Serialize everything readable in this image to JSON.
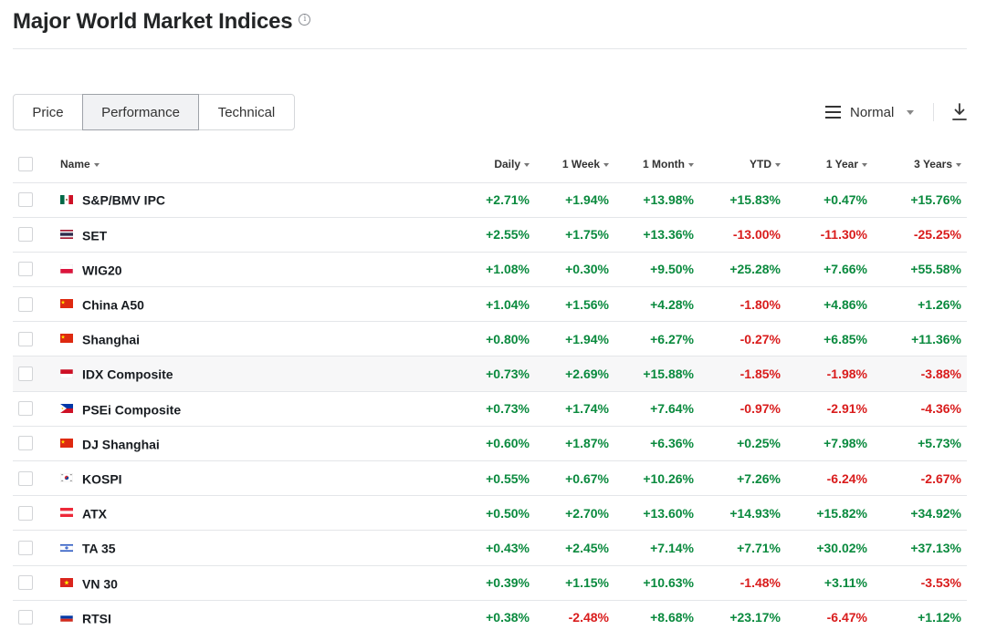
{
  "page": {
    "title": "Major World Market Indices"
  },
  "tabs": [
    {
      "label": "Price"
    },
    {
      "label": "Performance"
    },
    {
      "label": "Technical"
    }
  ],
  "view": {
    "label": "Normal"
  },
  "table": {
    "columns": [
      {
        "label": "Name"
      },
      {
        "label": "Daily"
      },
      {
        "label": "1 Week"
      },
      {
        "label": "1 Month"
      },
      {
        "label": "YTD"
      },
      {
        "label": "1 Year"
      },
      {
        "label": "3 Years"
      }
    ],
    "rows": [
      {
        "flag": "mexico-flag-icon",
        "name": "S&P/BMV IPC",
        "daily": "+2.71%",
        "week": "+1.94%",
        "month": "+13.98%",
        "ytd": "+15.83%",
        "year": "+0.47%",
        "three_years": "+15.76%"
      },
      {
        "flag": "thailand-flag-icon",
        "name": "SET",
        "daily": "+2.55%",
        "week": "+1.75%",
        "month": "+13.36%",
        "ytd": "-13.00%",
        "year": "-11.30%",
        "three_years": "-25.25%"
      },
      {
        "flag": "poland-flag-icon",
        "name": "WIG20",
        "daily": "+1.08%",
        "week": "+0.30%",
        "month": "+9.50%",
        "ytd": "+25.28%",
        "year": "+7.66%",
        "three_years": "+55.58%"
      },
      {
        "flag": "china-flag-icon",
        "name": "China A50",
        "daily": "+1.04%",
        "week": "+1.56%",
        "month": "+4.28%",
        "ytd": "-1.80%",
        "year": "+4.86%",
        "three_years": "+1.26%"
      },
      {
        "flag": "china-flag-icon",
        "name": "Shanghai",
        "daily": "+0.80%",
        "week": "+1.94%",
        "month": "+6.27%",
        "ytd": "-0.27%",
        "year": "+6.85%",
        "three_years": "+11.36%"
      },
      {
        "flag": "indonesia-flag-icon",
        "name": "IDX Composite",
        "daily": "+0.73%",
        "week": "+2.69%",
        "month": "+15.88%",
        "ytd": "-1.85%",
        "year": "-1.98%",
        "three_years": "-3.88%"
      },
      {
        "flag": "philippines-flag-icon",
        "name": "PSEi Composite",
        "daily": "+0.73%",
        "week": "+1.74%",
        "month": "+7.64%",
        "ytd": "-0.97%",
        "year": "-2.91%",
        "three_years": "-4.36%"
      },
      {
        "flag": "china-flag-icon",
        "name": "DJ Shanghai",
        "daily": "+0.60%",
        "week": "+1.87%",
        "month": "+6.36%",
        "ytd": "+0.25%",
        "year": "+7.98%",
        "three_years": "+5.73%"
      },
      {
        "flag": "south-korea-flag-icon",
        "name": "KOSPI",
        "daily": "+0.55%",
        "week": "+0.67%",
        "month": "+10.26%",
        "ytd": "+7.26%",
        "year": "-6.24%",
        "three_years": "-2.67%"
      },
      {
        "flag": "austria-flag-icon",
        "name": "ATX",
        "daily": "+0.50%",
        "week": "+2.70%",
        "month": "+13.60%",
        "ytd": "+14.93%",
        "year": "+15.82%",
        "three_years": "+34.92%"
      },
      {
        "flag": "israel-flag-icon",
        "name": "TA 35",
        "daily": "+0.43%",
        "week": "+2.45%",
        "month": "+7.14%",
        "ytd": "+7.71%",
        "year": "+30.02%",
        "three_years": "+37.13%"
      },
      {
        "flag": "vietnam-flag-icon",
        "name": "VN 30",
        "daily": "+0.39%",
        "week": "+1.15%",
        "month": "+10.63%",
        "ytd": "-1.48%",
        "year": "+3.11%",
        "three_years": "-3.53%"
      },
      {
        "flag": "russia-flag-icon",
        "name": "RTSI",
        "daily": "+0.38%",
        "week": "-2.48%",
        "month": "+8.68%",
        "ytd": "+23.17%",
        "year": "-6.47%",
        "three_years": "+1.12%"
      }
    ]
  },
  "colors": {
    "positive": "#0a8a3e",
    "negative": "#d91c1c",
    "text": "#181c21",
    "border": "#e4e6e9"
  }
}
